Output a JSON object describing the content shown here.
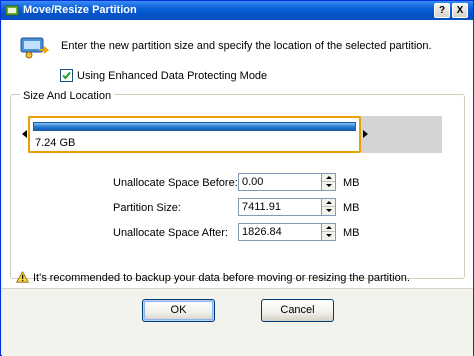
{
  "window": {
    "title": "Move/Resize Partition",
    "help_label": "?",
    "close_label": "X"
  },
  "instruction": "Enter the new partition size and specify the location of the selected partition.",
  "option": {
    "label": "Using Enhanced Data Protecting Mode",
    "checked": true
  },
  "group": {
    "legend": "Size And Location"
  },
  "partition_bar": {
    "size_label": "7.24 GB",
    "fill_fraction": 0.8
  },
  "fields": [
    {
      "label": "Unallocate Space Before:",
      "value": "0.00",
      "unit": "MB"
    },
    {
      "label": "Partition Size:",
      "value": "7411.91",
      "unit": "MB"
    },
    {
      "label": "Unallocate Space After:",
      "value": "1826.84",
      "unit": "MB"
    }
  ],
  "warning": "It's recommended to backup your data before moving or resizing the partition.",
  "buttons": {
    "ok": "OK",
    "cancel": "Cancel"
  },
  "colors": {
    "titlebar": "#0a5fd8",
    "selection_border": "#e8a200",
    "partition_fill": "#2f7fd6"
  }
}
